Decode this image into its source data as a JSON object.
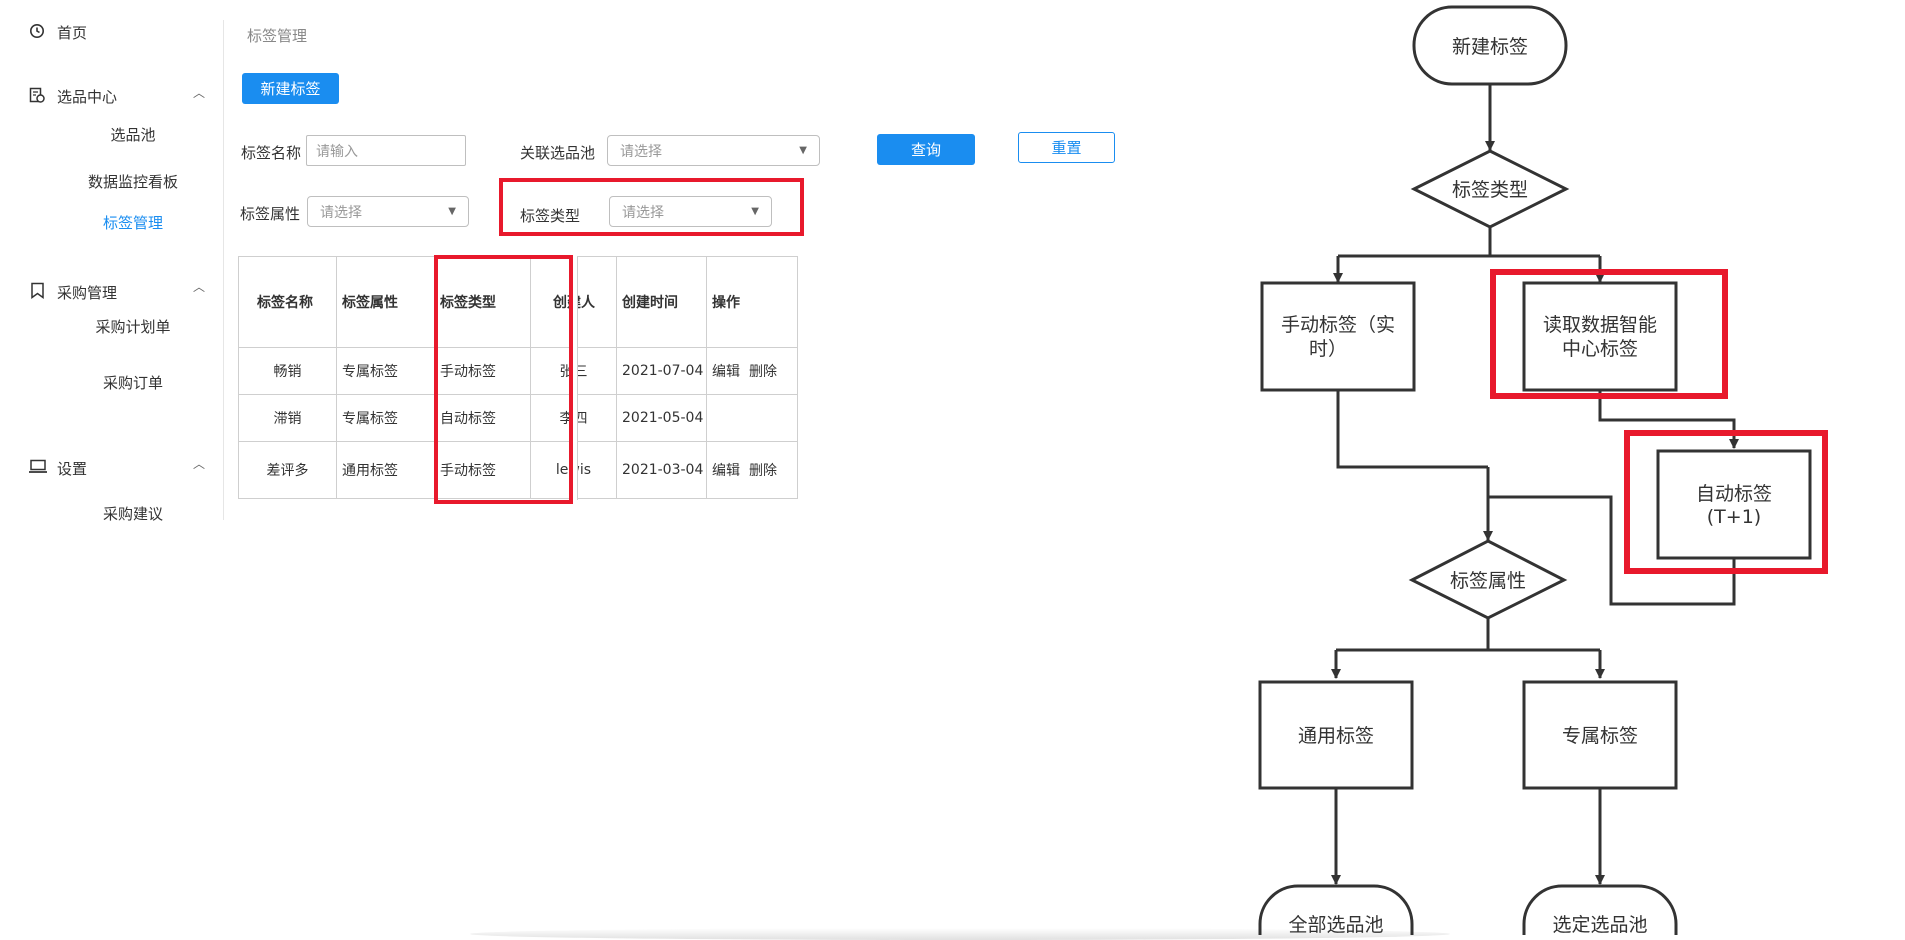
{
  "sidebar": {
    "home": "首页",
    "groups": [
      {
        "label": "选品中心",
        "icon": "report-icon",
        "items": [
          "选品池",
          "数据监控看板",
          "标签管理"
        ],
        "active_index": 2
      },
      {
        "label": "采购管理",
        "icon": "bookmark-icon",
        "items": [
          "采购计划单",
          "采购订单"
        ]
      },
      {
        "label": "设置",
        "icon": "laptop-icon",
        "items": [
          "采购建议"
        ]
      }
    ]
  },
  "breadcrumb": "标签管理",
  "actions": {
    "new_tag": "新建标签",
    "query": "查询",
    "reset": "重置"
  },
  "filters": {
    "tag_name": {
      "label": "标签名称",
      "placeholder": "请输入"
    },
    "pool": {
      "label": "关联选品池",
      "placeholder": "请选择"
    },
    "tag_attr": {
      "label": "标签属性",
      "placeholder": "请选择"
    },
    "tag_type": {
      "label": "标签类型",
      "placeholder": "请选择"
    }
  },
  "table": {
    "columns": [
      "标签名称",
      "标签属性",
      "标签类型",
      "创建人",
      "创建时间",
      "操作"
    ],
    "rows": [
      {
        "name": "畅销",
        "attr": "专属标签",
        "type": "手动标签",
        "creator": "张三",
        "time": "2021-07-04",
        "ops": [
          "编辑",
          "删除"
        ]
      },
      {
        "name": "滞销",
        "attr": "专属标签",
        "type": "自动标签",
        "creator": "李四",
        "time": "2021-05-04",
        "ops": [
          "",
          ""
        ]
      },
      {
        "name": "差评多",
        "attr": "通用标签",
        "type": "手动标签",
        "creator": "lewis",
        "time": "2021-03-04",
        "ops": [
          "编辑",
          "删除"
        ]
      }
    ]
  },
  "flowchart": {
    "start": "新建标签",
    "type_decision": "标签类型",
    "manual_line1": "手动标签（实",
    "manual_line2": "时）",
    "smart_line1": "读取数据智能",
    "smart_line2": "中心标签",
    "auto_line1": "自动标签",
    "auto_line2": "(T+1)",
    "attr_decision": "标签属性",
    "general": "通用标签",
    "exclusive": "专属标签",
    "all_pool": "全部选品池",
    "selected_pool": "选定选品池"
  },
  "colors": {
    "accent": "#1a8df0",
    "highlight": "#e8192c"
  }
}
